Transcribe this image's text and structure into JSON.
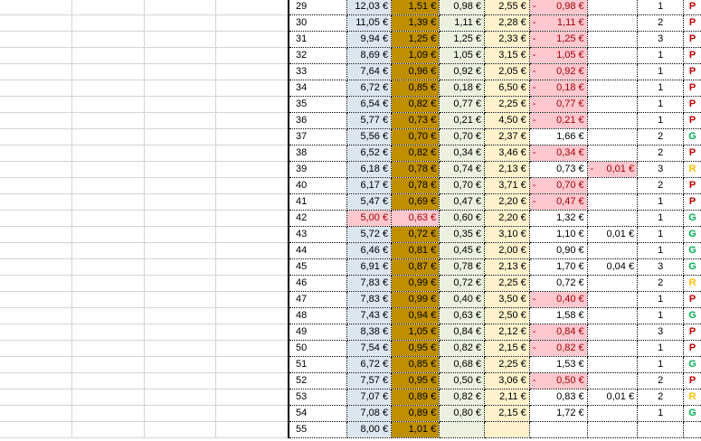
{
  "rows": [
    {
      "id": "29",
      "a": "12,03 €",
      "b": "1,51 €",
      "c": "0,98 €",
      "d": "2,55 €",
      "e": "0,98 €",
      "e_neg": true,
      "f": "",
      "f_neg": false,
      "g": "1",
      "s": "P"
    },
    {
      "id": "30",
      "a": "11,05 €",
      "b": "1,39 €",
      "c": "1,11 €",
      "d": "2,28 €",
      "e": "1,11 €",
      "e_neg": true,
      "f": "",
      "f_neg": false,
      "g": "2",
      "s": "P"
    },
    {
      "id": "31",
      "a": "9,94 €",
      "b": "1,25 €",
      "c": "1,25 €",
      "d": "2,33 €",
      "e": "1,25 €",
      "e_neg": true,
      "f": "",
      "f_neg": false,
      "g": "3",
      "s": "P"
    },
    {
      "id": "32",
      "a": "8,69 €",
      "b": "1,09 €",
      "c": "1,05 €",
      "d": "3,15 €",
      "e": "1,05 €",
      "e_neg": true,
      "f": "",
      "f_neg": false,
      "g": "1",
      "s": "P"
    },
    {
      "id": "33",
      "a": "7,64 €",
      "b": "0,96 €",
      "c": "0,92 €",
      "d": "2,05 €",
      "e": "0,92 €",
      "e_neg": true,
      "f": "",
      "f_neg": false,
      "g": "1",
      "s": "P"
    },
    {
      "id": "34",
      "a": "6,72 €",
      "b": "0,85 €",
      "c": "0,18 €",
      "d": "6,50 €",
      "e": "0,18 €",
      "e_neg": true,
      "f": "",
      "f_neg": false,
      "g": "1",
      "s": "P"
    },
    {
      "id": "35",
      "a": "6,54 €",
      "b": "0,82 €",
      "c": "0,77 €",
      "d": "2,25 €",
      "e": "0,77 €",
      "e_neg": true,
      "f": "",
      "f_neg": false,
      "g": "1",
      "s": "P"
    },
    {
      "id": "36",
      "a": "5,77 €",
      "b": "0,73 €",
      "c": "0,21 €",
      "d": "4,50 €",
      "e": "0,21 €",
      "e_neg": true,
      "f": "",
      "f_neg": false,
      "g": "1",
      "s": "P"
    },
    {
      "id": "37",
      "a": "5,56 €",
      "b": "0,70 €",
      "c": "0,70 €",
      "d": "2,37 €",
      "e": "1,66 €",
      "e_neg": false,
      "f": "",
      "f_neg": false,
      "g": "2",
      "s": "G"
    },
    {
      "id": "38",
      "a": "6,52 €",
      "b": "0,82 €",
      "c": "0,34 €",
      "d": "3,46 €",
      "e": "0,34 €",
      "e_neg": true,
      "f": "",
      "f_neg": false,
      "g": "2",
      "s": "P"
    },
    {
      "id": "39",
      "a": "6,18 €",
      "b": "0,78 €",
      "c": "0,74 €",
      "d": "2,13 €",
      "e": "0,73 €",
      "e_neg": false,
      "f": "0,01 €",
      "f_neg": true,
      "g": "3",
      "s": "R"
    },
    {
      "id": "40",
      "a": "6,17 €",
      "b": "0,78 €",
      "c": "0,70 €",
      "d": "3,71 €",
      "e": "0,70 €",
      "e_neg": true,
      "f": "",
      "f_neg": false,
      "g": "2",
      "s": "P"
    },
    {
      "id": "41",
      "a": "5,47 €",
      "b": "0,69 €",
      "c": "0,47 €",
      "d": "2,20 €",
      "e": "0,47 €",
      "e_neg": true,
      "f": "",
      "f_neg": false,
      "g": "1",
      "s": "P"
    },
    {
      "id": "42",
      "a": "5,00 €",
      "a_pink": true,
      "b": "0,63 €",
      "b_pink": true,
      "c": "0,60 €",
      "d": "2,20 €",
      "e": "1,32 €",
      "e_neg": false,
      "f": "",
      "f_neg": false,
      "g": "1",
      "s": "G"
    },
    {
      "id": "43",
      "a": "5,72 €",
      "b": "0,72 €",
      "c": "0,35 €",
      "d": "3,10 €",
      "e": "1,10 €",
      "e_neg": false,
      "f": "0,01 €",
      "f_neg": false,
      "g": "1",
      "s": "G"
    },
    {
      "id": "44",
      "a": "6,46 €",
      "b": "0,81 €",
      "c": "0,45 €",
      "d": "2,00 €",
      "e": "0,90 €",
      "e_neg": false,
      "f": "",
      "f_neg": false,
      "g": "1",
      "s": "G"
    },
    {
      "id": "45",
      "a": "6,91 €",
      "b": "0,87 €",
      "c": "0,78 €",
      "d": "2,13 €",
      "e": "1,70 €",
      "e_neg": false,
      "f": "0,04 €",
      "f_neg": false,
      "g": "3",
      "s": "G"
    },
    {
      "id": "46",
      "a": "7,83 €",
      "b": "0,99 €",
      "c": "0,72 €",
      "d": "2,25 €",
      "e": "0,72 €",
      "e_neg": false,
      "f": "",
      "f_neg": false,
      "g": "2",
      "s": "R"
    },
    {
      "id": "47",
      "a": "7,83 €",
      "b": "0,99 €",
      "c": "0,40 €",
      "d": "3,50 €",
      "e": "0,40 €",
      "e_neg": true,
      "f": "",
      "f_neg": false,
      "g": "1",
      "s": "P"
    },
    {
      "id": "48",
      "a": "7,43 €",
      "b": "0,94 €",
      "c": "0,63 €",
      "d": "2,50 €",
      "e": "1,58 €",
      "e_neg": false,
      "f": "",
      "f_neg": false,
      "g": "1",
      "s": "G"
    },
    {
      "id": "49",
      "a": "8,38 €",
      "b": "1,05 €",
      "c": "0,84 €",
      "d": "2,12 €",
      "e": "0,84 €",
      "e_neg": true,
      "f": "",
      "f_neg": false,
      "g": "3",
      "s": "P"
    },
    {
      "id": "50",
      "a": "7,54 €",
      "b": "0,95 €",
      "c": "0,82 €",
      "d": "2,15 €",
      "e": "0,82 €",
      "e_neg": true,
      "f": "",
      "f_neg": false,
      "g": "1",
      "s": "P"
    },
    {
      "id": "51",
      "a": "6,72 €",
      "b": "0,85 €",
      "c": "0,68 €",
      "d": "2,25 €",
      "e": "1,53 €",
      "e_neg": false,
      "f": "",
      "f_neg": false,
      "g": "1",
      "s": "G"
    },
    {
      "id": "52",
      "a": "7,57 €",
      "b": "0,95 €",
      "c": "0,50 €",
      "d": "3,06 €",
      "e": "0,50 €",
      "e_neg": true,
      "f": "",
      "f_neg": false,
      "g": "2",
      "s": "P"
    },
    {
      "id": "53",
      "a": "7,07 €",
      "b": "0,89 €",
      "c": "0,82 €",
      "d": "2,11 €",
      "e": "0,83 €",
      "e_neg": false,
      "f": "0,01 €",
      "f_neg": false,
      "g": "2",
      "s": "R"
    },
    {
      "id": "54",
      "a": "7,08 €",
      "b": "0,89 €",
      "c": "0,80 €",
      "d": "2,15 €",
      "e": "1,72 €",
      "e_neg": false,
      "f": "",
      "f_neg": false,
      "g": "1",
      "s": "G"
    },
    {
      "id": "55",
      "a": "8,00 €",
      "b": "1,01 €",
      "c": "",
      "d": "",
      "e": "",
      "e_neg": false,
      "f": "",
      "f_neg": false,
      "g": "",
      "s": ""
    }
  ],
  "colors": {
    "blue": "#dce6f1",
    "gold": "#bf8f00",
    "green": "#ebf1de",
    "yellow": "#fff2cc",
    "pink": "#ffc7ce",
    "status_P": "#c00000",
    "status_G": "#00b050",
    "status_R": "#ffc000"
  }
}
